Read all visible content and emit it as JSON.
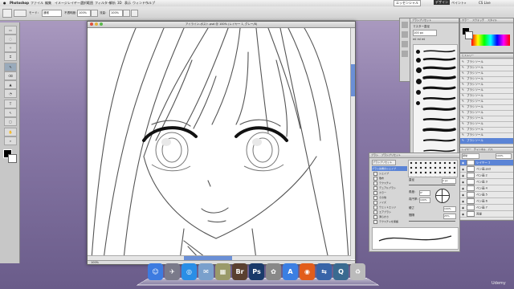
{
  "menubar": {
    "apple": "",
    "app_name": "Photoshop",
    "items": [
      "ファイル",
      "編集",
      "イメージ",
      "レイヤー",
      "選択範囲",
      "フィルター",
      "解析",
      "3D",
      "表示",
      "ウィンドウ",
      "ヘルプ"
    ],
    "right_workspace": "エッセンシャル",
    "right_links": [
      "デザイン",
      "ペイント",
      "»"
    ],
    "clock": "CS Live"
  },
  "options": {
    "size_label": "サイズ：",
    "mode_label": "モード：",
    "mode_value": "通常",
    "opacity_label": "不透明度：",
    "opacity_value": "100%",
    "flow_label": "流量：",
    "flow_value": "100%"
  },
  "tools": [
    "▭",
    "◌",
    "✧",
    "⌗",
    "✎",
    "⌫",
    "▲",
    "◔",
    "T",
    "↖",
    "▢",
    "✋",
    "⌕",
    "■"
  ],
  "document": {
    "title": "アイライン-ポスト.psd @ 100% (レイヤー 1, グレー/8)",
    "status": "100%"
  },
  "swatches_panel": {
    "tabs": [
      "カラー",
      "スウォッチ",
      "スタイル"
    ]
  },
  "brush_preset_panel": {
    "tabs": [
      "ブラシプリセット"
    ],
    "header": "マスター直径",
    "mode_text": "ml ml ml",
    "size_value": "100 px"
  },
  "brush_panel": {
    "tabs": [
      "ブラシ",
      "ブラシプリセット"
    ],
    "preset_button": "ブラシプリセット",
    "options": [
      "ブラシ先端のシェイプ",
      "シェイプ",
      "散布",
      "テクスチャ",
      "デュアルブラシ",
      "カラー",
      "その他",
      "ノイズ",
      "ウェットエッジ",
      "エアブラシ",
      "滑らかさ",
      "テクスチャを保護"
    ],
    "size_label": "直径",
    "size_value": "2 px",
    "angle_label": "角度：",
    "angle_value": "0°",
    "roundness_label": "真円率：",
    "roundness_value": "100%",
    "hardness_label": "硬さ",
    "hardness_value": "100%",
    "spacing_label": "間隔",
    "spacing_value": "25%"
  },
  "history_panel": {
    "tabs": [
      "ヒストリー"
    ],
    "items": [
      "ブラシツール",
      "ブラシツール",
      "ブラシツール",
      "ブラシツール",
      "ブラシツール",
      "ブラシツール",
      "ブラシツール",
      "ブラシツール",
      "ブラシツール",
      "ブラシツール",
      "ブラシツール",
      "ブラシツール",
      "ブラシツール",
      "ブラシツール",
      "ブラシツール"
    ]
  },
  "layers_panel": {
    "tabs": [
      "レイヤー",
      "チャンネル",
      "パス"
    ],
    "blend": "通常",
    "opacity_label": "不透明度：",
    "opacity_value": "100%",
    "fill_label": "塗り：",
    "fill_value": "100%",
    "layers": [
      "レイヤー 1",
      "ペン画.psd",
      "ペン画 2",
      "ペン画 3",
      "ペン画 4",
      "ペン画 5",
      "ペン画 6",
      "ペン画 7",
      "背景"
    ]
  },
  "dock": {
    "icons": [
      {
        "name": "finder-icon",
        "glyph": "☺",
        "color": "#3d7be0"
      },
      {
        "name": "launchpad-icon",
        "glyph": "✈",
        "color": "#7a7a8a"
      },
      {
        "name": "safari-icon",
        "glyph": "◎",
        "color": "#2a8ee6"
      },
      {
        "name": "mail-icon",
        "glyph": "✉",
        "color": "#7aa0cc"
      },
      {
        "name": "preview-icon",
        "glyph": "▦",
        "color": "#9a9a6a"
      },
      {
        "name": "bridge-icon",
        "glyph": "Br",
        "color": "#5a4030"
      },
      {
        "name": "photoshop-icon",
        "glyph": "Ps",
        "color": "#1a3a6a"
      },
      {
        "name": "photos-icon",
        "glyph": "✿",
        "color": "#888"
      },
      {
        "name": "appstore-icon",
        "glyph": "A",
        "color": "#3b7fe3"
      },
      {
        "name": "firefox-icon",
        "glyph": "◉",
        "color": "#e25d1c"
      },
      {
        "name": "screen-sharing-icon",
        "glyph": "⇆",
        "color": "#3864a8"
      },
      {
        "name": "quicktime-icon",
        "glyph": "Q",
        "color": "#3a6a90"
      },
      {
        "name": "trash-icon",
        "glyph": "♻",
        "color": "#bbb"
      }
    ]
  },
  "watermark": "Udemy",
  "colors": {
    "accent": "#6a8fd6",
    "selected_row": "#5b84d6",
    "canvas_bg": "#ffffff"
  }
}
